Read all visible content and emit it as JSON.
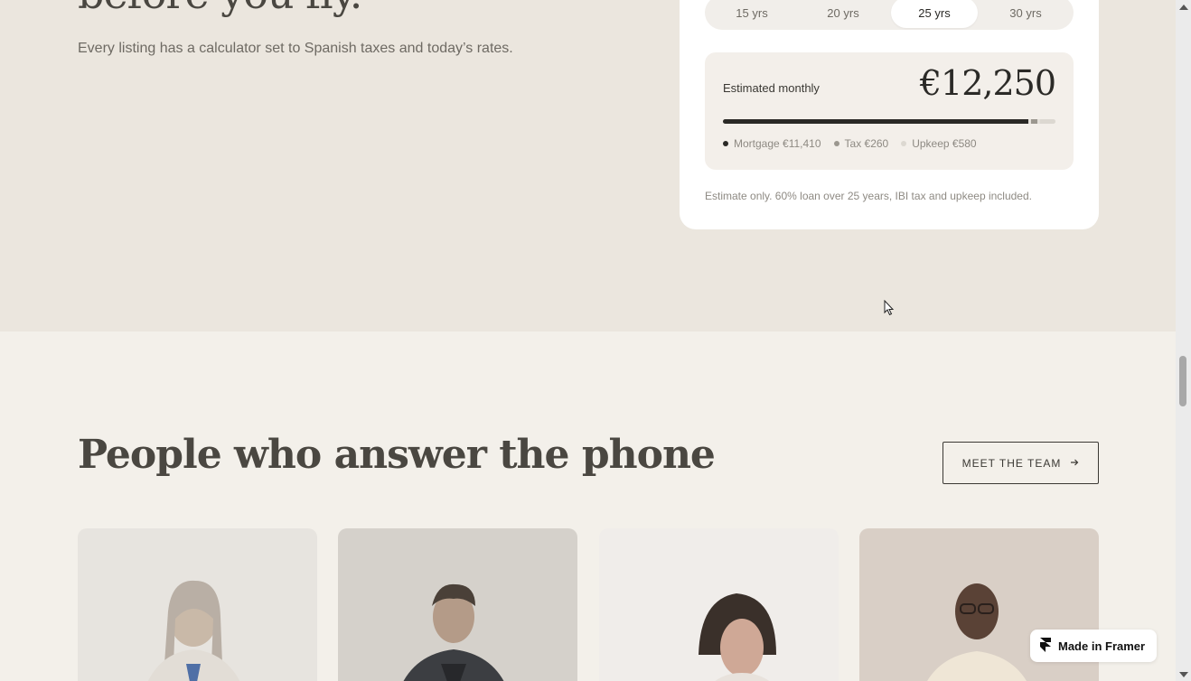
{
  "hero": {
    "headline_fragment": "before you fly.",
    "intro": "Every listing has a calculator set to Spanish taxes and today’s rates."
  },
  "calculator": {
    "terms": [
      "15 yrs",
      "20 yrs",
      "25 yrs",
      "30 yrs"
    ],
    "active_term": "25 yrs",
    "estimate_label": "Estimated monthly",
    "estimate_value": "€12,250",
    "breakdown": [
      {
        "label": "Mortgage €11,410",
        "amount": 11410,
        "color": "#2a2926"
      },
      {
        "label": "Tax €260",
        "amount": 260,
        "color": "#9b978f"
      },
      {
        "label": "Upkeep €580",
        "amount": 580,
        "color": "#dcd8d1"
      }
    ],
    "note": "Estimate only. 60% loan over 25 years, IBI tax and upkeep included."
  },
  "team": {
    "heading": "People who answer the phone",
    "button_label": "MEET THE TEAM",
    "button_icon": "arrow-right-icon"
  },
  "badge": {
    "label": "Made in Framer",
    "icon": "framer-logo-icon"
  },
  "colors": {
    "top_bg": "#ebe6de",
    "page_bg": "#f3f0ea",
    "accent_dark": "#2a2926"
  }
}
